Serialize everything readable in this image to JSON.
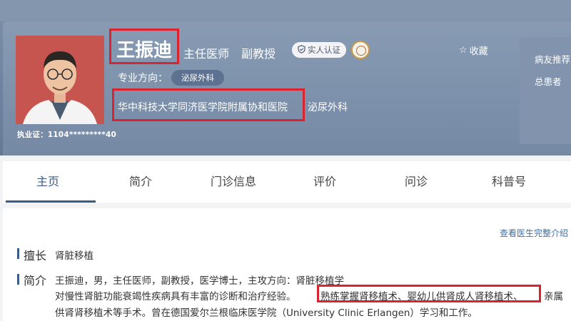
{
  "doctor": {
    "name": "王振迪",
    "title": "主任医师",
    "academic_title": "副教授",
    "verify_label": "实人认证",
    "favorite_label": "收藏",
    "license": "执业证：1104*********40",
    "specialty_label": "专业方向：",
    "specialty_tag": "泌尿外科",
    "hospital": "华中科技大学同济医学院附属协和医院",
    "department": "泌尿外科"
  },
  "side_panel": {
    "recommend": "病友推荐",
    "patients": "总患者"
  },
  "tabs": [
    {
      "label": "主页"
    },
    {
      "label": "简介"
    },
    {
      "label": "门诊信息"
    },
    {
      "label": "评价"
    },
    {
      "label": "问诊"
    },
    {
      "label": "科普号"
    }
  ],
  "content": {
    "full_intro_link": "查看医生完整介绍",
    "expertise_label": "擅长",
    "expertise_text": "肾脏移植",
    "intro_label": "简介",
    "intro_line1": "王振迪，男，主任医师，副教授，医学博士，主攻方向：肾脏移植学",
    "intro_line2_a": "对慢性肾脏功能衰竭性疾病具有丰富的诊断和治疗经验。",
    "intro_line2_b": "熟练掌握肾移植术、婴幼儿供肾成人肾移植术、",
    "intro_line2_c": "亲属",
    "intro_line3": "供肾肾移植术等手术。曾在德国爱尔兰根临床医学院（University Clinic Erlangen）学习和工作。"
  },
  "colors": {
    "accent": "#3c5a88",
    "highlight_border": "#d9232e",
    "header": "#7589a5"
  }
}
